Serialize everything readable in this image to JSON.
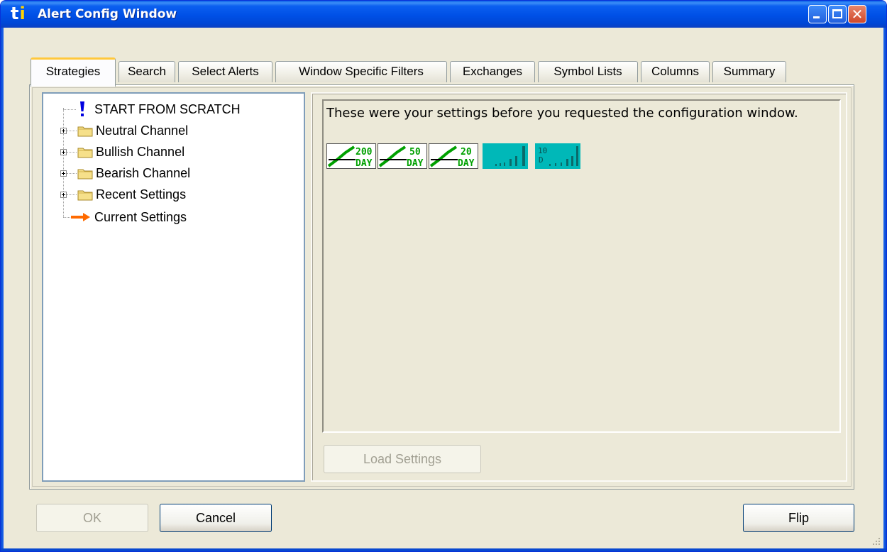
{
  "window": {
    "logo_t": "t",
    "logo_i": "i",
    "title": "Alert Config Window",
    "close_glyph": "✕"
  },
  "tabs": [
    {
      "label": "Strategies",
      "active": true
    },
    {
      "label": "Search",
      "active": false
    },
    {
      "label": "Select Alerts",
      "active": false
    },
    {
      "label": "Window Specific Filters",
      "active": false
    },
    {
      "label": "Exchanges",
      "active": false
    },
    {
      "label": "Symbol Lists",
      "active": false
    },
    {
      "label": "Columns",
      "active": false
    },
    {
      "label": "Summary",
      "active": false
    }
  ],
  "tree": {
    "items": [
      {
        "label": "START FROM SCRATCH",
        "icon": "exclamation-icon"
      },
      {
        "label": "Neutral Channel",
        "icon": "folder-icon",
        "expandable": true
      },
      {
        "label": "Bullish Channel",
        "icon": "folder-icon",
        "expandable": true
      },
      {
        "label": "Bearish Channel",
        "icon": "folder-icon",
        "expandable": true
      },
      {
        "label": "Recent Settings",
        "icon": "folder-icon",
        "expandable": true
      },
      {
        "label": "Current Settings",
        "icon": "right-arrow-icon"
      }
    ]
  },
  "settings": {
    "description": "These were your settings before you requested the configuration window.",
    "icons": [
      {
        "name": "ma-200-day-icon",
        "top": "200",
        "bottom": "DAY"
      },
      {
        "name": "ma-50-day-icon",
        "top": "50",
        "bottom": "DAY"
      },
      {
        "name": "ma-20-day-icon",
        "top": "20",
        "bottom": "DAY"
      },
      {
        "name": "volume-bars-icon"
      },
      {
        "name": "volume-10-day-icon",
        "top": "10",
        "bottom": "D"
      }
    ],
    "load_button": "Load Settings"
  },
  "footer": {
    "ok": "OK",
    "cancel": "Cancel",
    "flip": "Flip"
  },
  "colors": {
    "title_bar": "#0054e3",
    "active_tab_accent": "#ffc83c",
    "icon_green": "#00a000",
    "icon_cyan": "#00b8b8",
    "arrow_orange": "#ff6a00"
  }
}
